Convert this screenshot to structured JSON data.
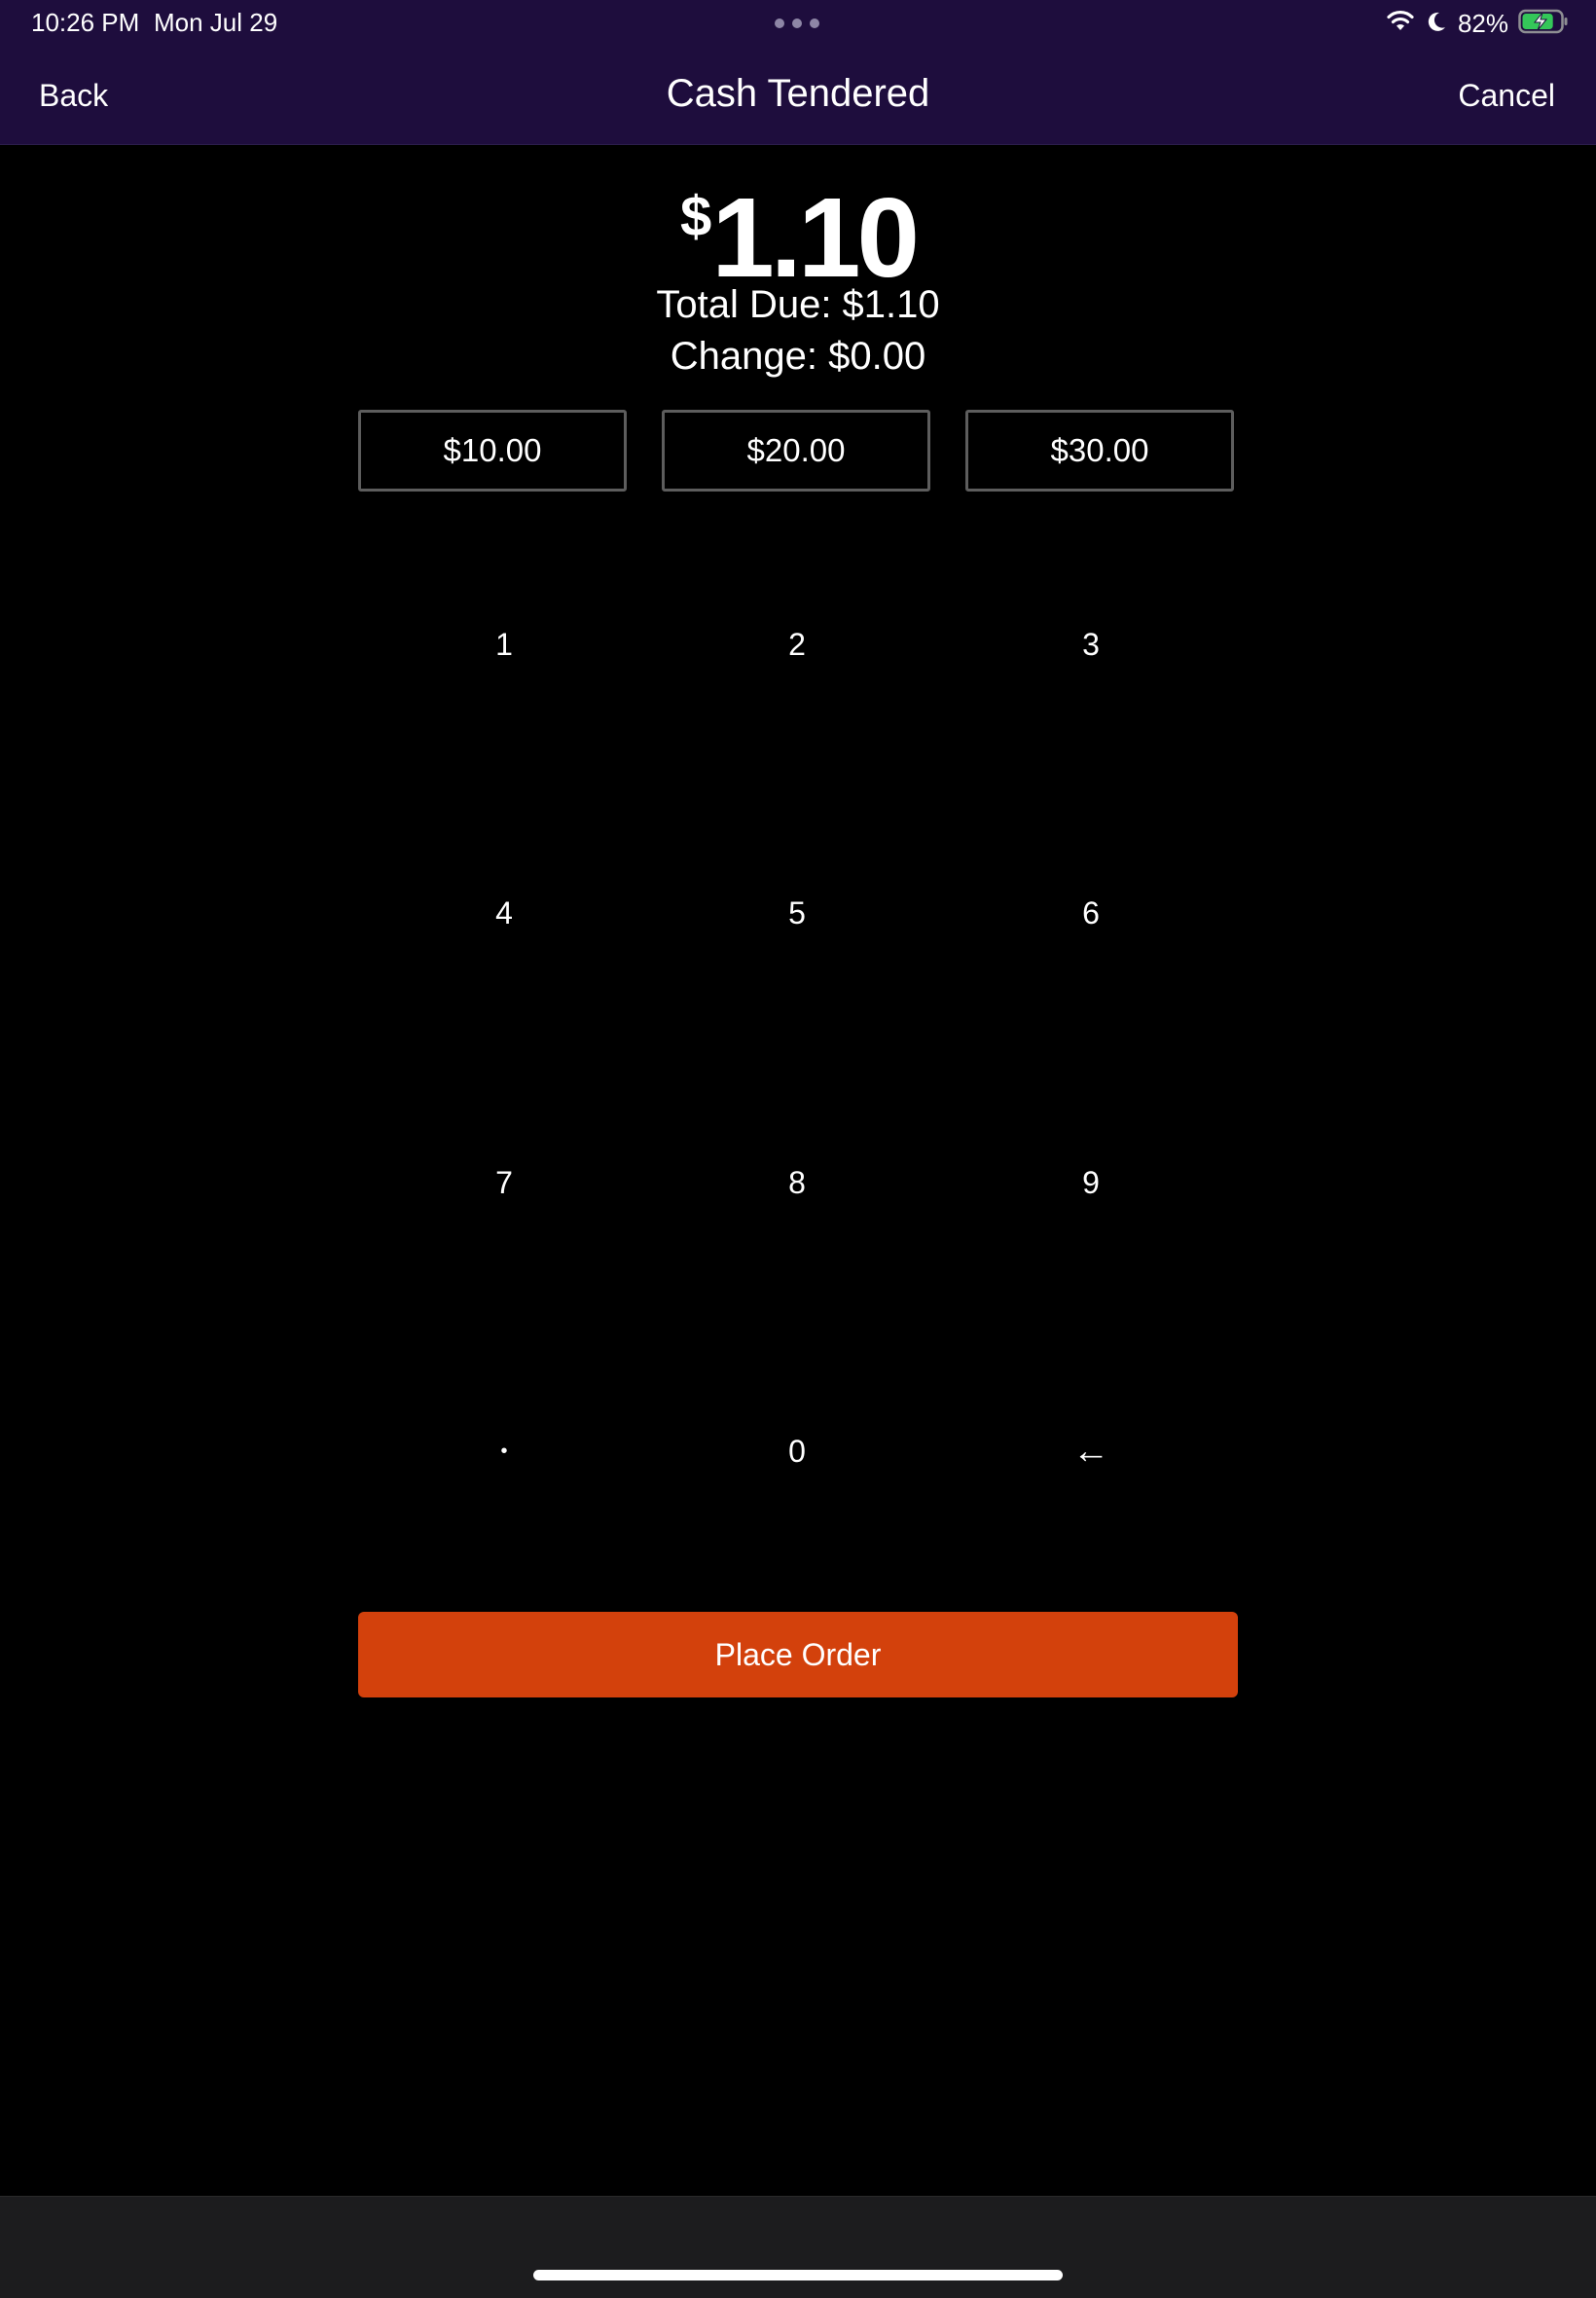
{
  "status_bar": {
    "time": "10:26 PM",
    "date": "Mon Jul 29",
    "battery_percent": "82%",
    "battery_level": 0.82,
    "icons": [
      "wifi-icon",
      "moon-icon",
      "battery-charging-icon"
    ]
  },
  "nav": {
    "back_label": "Back",
    "title": "Cash Tendered",
    "cancel_label": "Cancel"
  },
  "amount": {
    "currency_symbol": "$",
    "value": "1.10"
  },
  "summary": {
    "total_due": "Total Due: $1.10",
    "change": "Change: $0.00"
  },
  "quick_amounts": [
    "$10.00",
    "$20.00",
    "$30.00"
  ],
  "keypad": {
    "keys": [
      "1",
      "2",
      "3",
      "4",
      "5",
      "6",
      "7",
      "8",
      "9",
      "•",
      "0",
      "←"
    ]
  },
  "place_order_label": "Place Order",
  "colors": {
    "header_bg": "#1e0d3d",
    "accent": "#d3410c",
    "background": "#000000"
  }
}
